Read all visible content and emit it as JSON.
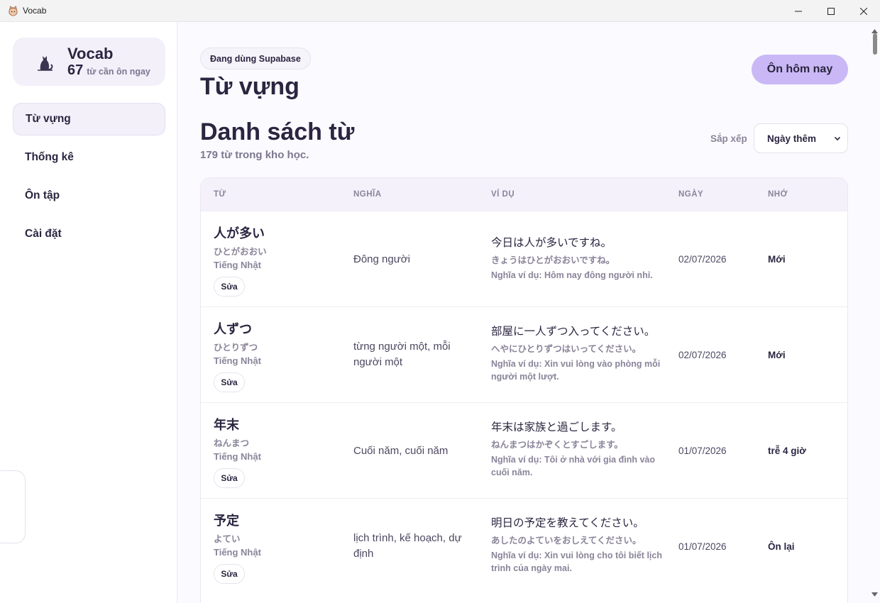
{
  "window": {
    "title": "Vocab",
    "controls": {
      "minimize": "—",
      "maximize": "☐",
      "close": "✕"
    }
  },
  "sidebar": {
    "brand": {
      "name": "Vocab",
      "due_count": "67",
      "due_label": "từ cần ôn ngay"
    },
    "nav": [
      {
        "label": "Từ vựng",
        "active": true
      },
      {
        "label": "Thống kê",
        "active": false
      },
      {
        "label": "Ôn tập",
        "active": false
      },
      {
        "label": "Cài đặt",
        "active": false
      }
    ]
  },
  "main": {
    "badge": "Đang dùng Supabase",
    "page_title": "Từ vựng",
    "review_button": "Ôn hôm nay",
    "list_title": "Danh sách từ",
    "list_subtitle": "179 từ trong kho học.",
    "sort": {
      "label": "Sắp xếp",
      "selected": "Ngày thêm"
    }
  },
  "table": {
    "headers": [
      "TỪ",
      "NGHĨA",
      "VÍ DỤ",
      "NGÀY",
      "NHỚ"
    ],
    "edit_label": "Sửa",
    "rows": [
      {
        "word": "人が多い",
        "kana": "ひとがおおい",
        "language": "Tiếng Nhật",
        "meaning": "Đông người",
        "example": "今日は人が多いですね。",
        "example_kana": "きょうはひとがおおいですね。",
        "example_meaning": "Nghĩa ví dụ: Hôm nay đông người nhỉ.",
        "date": "02/07/2026",
        "memory": "Mới"
      },
      {
        "word": "人ずつ",
        "kana": "ひとりずつ",
        "language": "Tiếng Nhật",
        "meaning": "từng người một, mỗi người một",
        "example": "部屋に一人ずつ入ってください。",
        "example_kana": "へやにひとりずつはいってください。",
        "example_meaning": "Nghĩa ví dụ: Xin vui lòng vào phòng mỗi người một lượt.",
        "date": "02/07/2026",
        "memory": "Mới"
      },
      {
        "word": "年末",
        "kana": "ねんまつ",
        "language": "Tiếng Nhật",
        "meaning": "Cuối năm, cuối năm",
        "example": "年末は家族と過ごします。",
        "example_kana": "ねんまつはかぞくとすごします。",
        "example_meaning": "Nghĩa ví dụ: Tôi ở nhà với gia đình vào cuối năm.",
        "date": "01/07/2026",
        "memory": "trễ 4 giờ"
      },
      {
        "word": "予定",
        "kana": "よてい",
        "language": "Tiếng Nhật",
        "meaning": "lịch trình, kế hoạch, dự định",
        "example": "明日の予定を教えてください。",
        "example_kana": "あしたのよていをおしえてください。",
        "example_meaning": "Nghĩa ví dụ: Xin vui lòng cho tôi biết lịch trình của ngày mai.",
        "date": "01/07/2026",
        "memory": "Ôn lại"
      }
    ]
  }
}
